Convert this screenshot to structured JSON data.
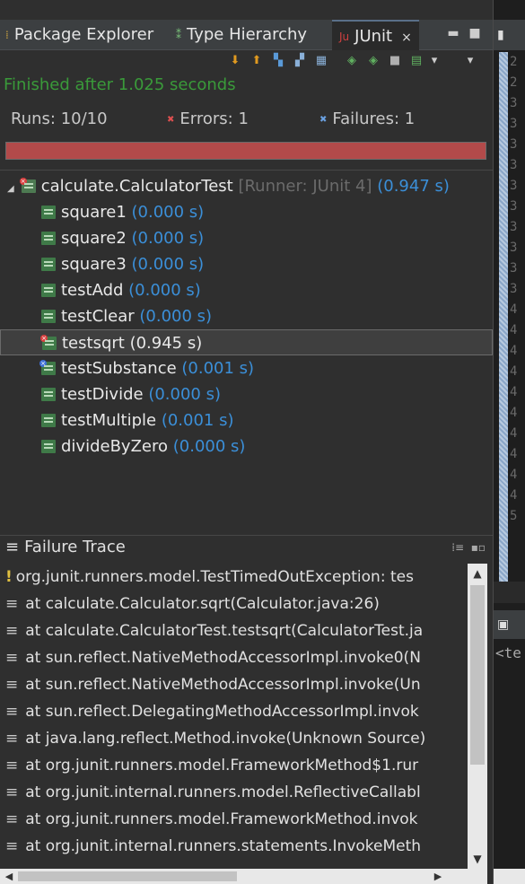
{
  "tabs": [
    {
      "label": "Package Explorer",
      "icon": "package-icon"
    },
    {
      "label": "Type Hierarchy",
      "icon": "hierarchy-icon"
    },
    {
      "label": "JUnit",
      "icon": "junit-icon",
      "active": true,
      "close": "×"
    }
  ],
  "status": {
    "finished": "Finished after 1.025 seconds"
  },
  "counters": {
    "runs_label": "Runs:",
    "runs_value": "10/10",
    "errors_label": "Errors:",
    "errors_value": "1",
    "failures_label": "Failures:",
    "failures_value": "1"
  },
  "progress": {
    "fraction": 1.0,
    "color": "#b24a4a"
  },
  "tree": {
    "root": {
      "name": "calculate.CalculatorTest",
      "runner": "[Runner: JUnit 4]",
      "time": "(0.947 s)"
    },
    "tests": [
      {
        "name": "square1",
        "time": "(0.000 s)",
        "status": "ok"
      },
      {
        "name": "square2",
        "time": "(0.000 s)",
        "status": "ok"
      },
      {
        "name": "square3",
        "time": "(0.000 s)",
        "status": "ok"
      },
      {
        "name": "testAdd",
        "time": "(0.000 s)",
        "status": "ok"
      },
      {
        "name": "testClear",
        "time": "(0.000 s)",
        "status": "ok"
      },
      {
        "name": "testsqrt",
        "time": "(0.945 s)",
        "status": "error",
        "selected": true
      },
      {
        "name": "testSubstance",
        "time": "(0.001 s)",
        "status": "failure"
      },
      {
        "name": "testDivide",
        "time": "(0.000 s)",
        "status": "ok"
      },
      {
        "name": "testMultiple",
        "time": "(0.001 s)",
        "status": "ok"
      },
      {
        "name": "divideByZero",
        "time": "(0.000 s)",
        "status": "ok"
      }
    ]
  },
  "failure_trace": {
    "title": "Failure Trace",
    "lines": [
      "org.junit.runners.model.TestTimedOutException: tes",
      "at calculate.Calculator.sqrt(Calculator.java:26)",
      "at calculate.CalculatorTest.testsqrt(CalculatorTest.ja",
      "at sun.reflect.NativeMethodAccessorImpl.invoke0(N",
      "at sun.reflect.NativeMethodAccessorImpl.invoke(Un",
      "at sun.reflect.DelegatingMethodAccessorImpl.invok",
      "at java.lang.reflect.Method.invoke(Unknown Source)",
      "at org.junit.runners.model.FrameworkMethod$1.rur",
      "at org.junit.internal.runners.model.ReflectiveCallabl",
      "at org.junit.runners.model.FrameworkMethod.invok",
      "at org.junit.internal.runners.statements.InvokeMeth"
    ]
  },
  "editor": {
    "line_numbers": [
      "2",
      "2",
      "3",
      "3",
      "3",
      "3",
      "3",
      "3",
      "3",
      "3",
      "3",
      "3",
      "4",
      "4",
      "4",
      "4",
      "4",
      "4",
      "4",
      "4",
      "4",
      "4",
      "5"
    ],
    "bottom_text": "<te"
  }
}
